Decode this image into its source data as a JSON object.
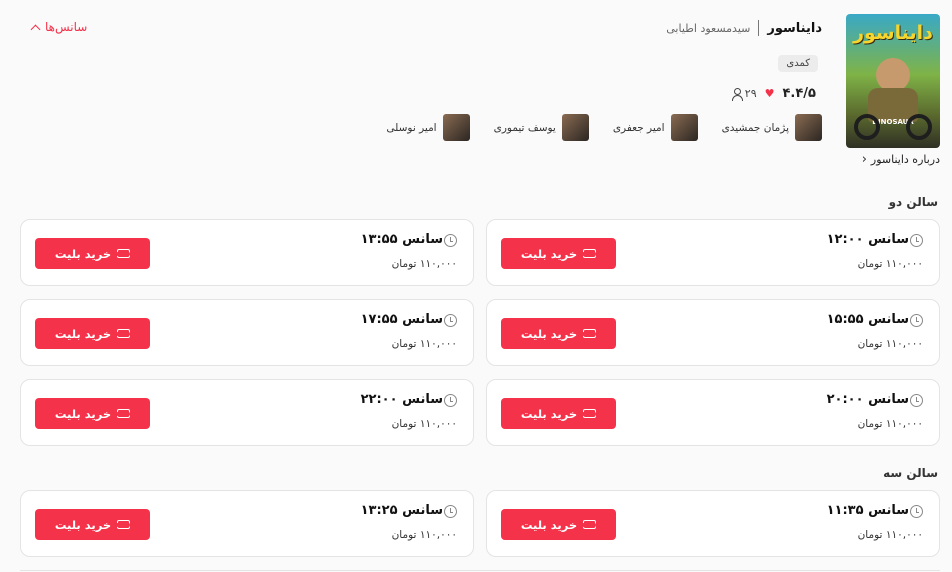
{
  "film": {
    "title": "دایناسور",
    "director": "سیدمسعود اطیابی",
    "genre": "کمدی",
    "rating": "۴.۴/۵",
    "votes": "۲۹",
    "about": "درباره دایناسور",
    "poster_title": "دایناسور",
    "poster_sub": "DINOSAUR",
    "cast": [
      "پژمان جمشیدی",
      "امیر جعفری",
      "یوسف تیموری",
      "امیر نوسلی"
    ]
  },
  "sessions_toggle": "سانس‌ها",
  "halls": [
    {
      "name": "سالن دو",
      "sessions": [
        {
          "time": "سانس ۱۲:۰۰",
          "price": "۱۱۰,۰۰۰ تومان",
          "button": "خرید بلیت"
        },
        {
          "time": "سانس ۱۳:۵۵",
          "price": "۱۱۰,۰۰۰ تومان",
          "button": "خرید بلیت"
        },
        {
          "time": "سانس ۱۵:۵۵",
          "price": "۱۱۰,۰۰۰ تومان",
          "button": "خرید بلیت"
        },
        {
          "time": "سانس ۱۷:۵۵",
          "price": "۱۱۰,۰۰۰ تومان",
          "button": "خرید بلیت"
        },
        {
          "time": "سانس ۲۰:۰۰",
          "price": "۱۱۰,۰۰۰ تومان",
          "button": "خرید بلیت"
        },
        {
          "time": "سانس ۲۲:۰۰",
          "price": "۱۱۰,۰۰۰ تومان",
          "button": "خرید بلیت"
        }
      ]
    },
    {
      "name": "سالن سه",
      "sessions": [
        {
          "time": "سانس ۱۱:۳۵",
          "price": "۱۱۰,۰۰۰ تومان",
          "button": "خرید بلیت"
        },
        {
          "time": "سانس ۱۳:۲۵",
          "price": "۱۱۰,۰۰۰ تومان",
          "button": "خرید بلیت"
        }
      ]
    }
  ],
  "colors": {
    "accent": "#f4324a"
  }
}
